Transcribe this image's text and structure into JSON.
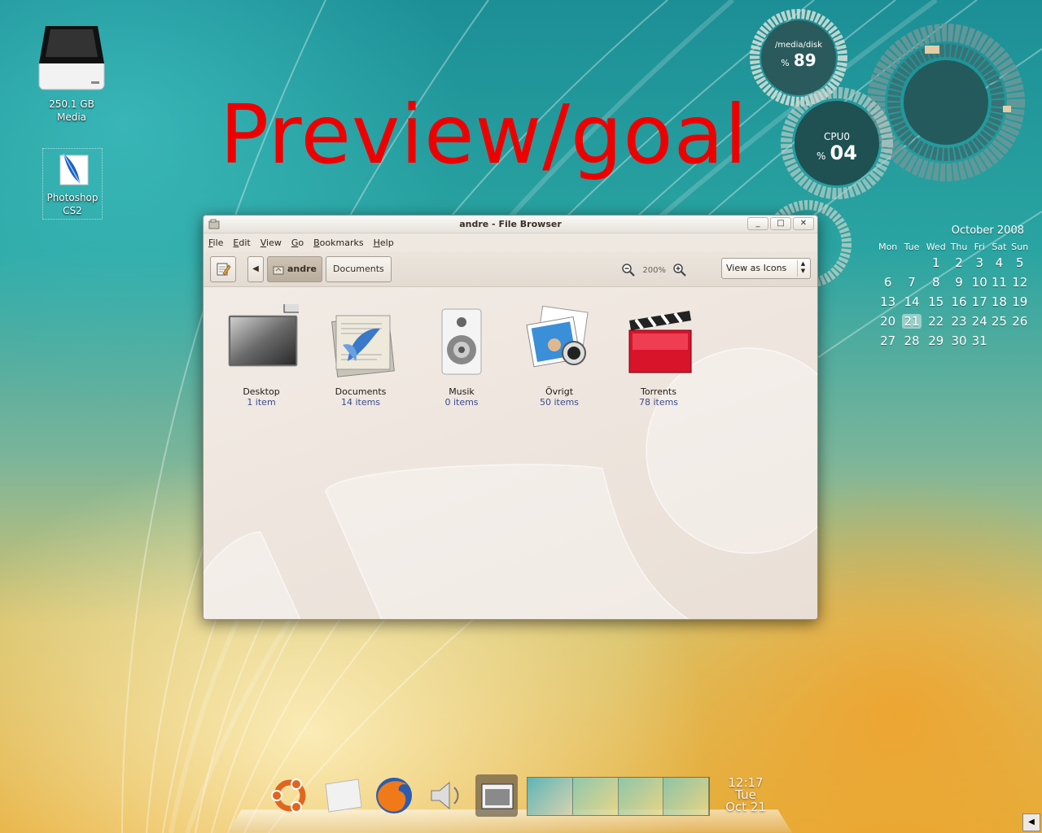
{
  "overlay_title": "Preview/goal",
  "desktop": {
    "icons": [
      {
        "label": "250.1 GB\nMedia",
        "icon": "hard-drive-icon"
      },
      {
        "label": "Photoshop\nCS2",
        "icon": "photoshop-feather-icon"
      }
    ]
  },
  "widgets": {
    "disk": {
      "path": "/media/disk",
      "pct_symbol": "%",
      "value": "89"
    },
    "cpu": {
      "label": "CPU0",
      "pct_symbol": "%",
      "value": "04"
    },
    "calendar": {
      "month": "October 2008",
      "weekdays": [
        "Mon",
        "Tue",
        "Wed",
        "Thu",
        "Fri",
        "Sat",
        "Sun"
      ],
      "weeks": [
        [
          "",
          "",
          "1",
          "2",
          "3",
          "4",
          "5"
        ],
        [
          "6",
          "7",
          "8",
          "9",
          "10",
          "11",
          "12"
        ],
        [
          "13",
          "14",
          "15",
          "16",
          "17",
          "18",
          "19"
        ],
        [
          "20",
          "21",
          "22",
          "23",
          "24",
          "25",
          "26"
        ],
        [
          "27",
          "28",
          "29",
          "30",
          "31",
          "",
          ""
        ]
      ],
      "today": "21"
    }
  },
  "window": {
    "title": "andre - File Browser",
    "buttons": {
      "minimize": "_",
      "maximize": "□",
      "close": "✕"
    },
    "menu": [
      {
        "key": "F",
        "rest": "ile"
      },
      {
        "key": "E",
        "rest": "dit"
      },
      {
        "key": "V",
        "rest": "iew"
      },
      {
        "key": "G",
        "rest": "o"
      },
      {
        "key": "B",
        "rest": "ookmarks"
      },
      {
        "key": "H",
        "rest": "elp"
      }
    ],
    "toolbar": {
      "back_glyph": "◀",
      "crumbs": [
        "andre",
        "Documents"
      ],
      "zoom_level": "200%",
      "view_mode": "View as Icons",
      "view_arrows": "▲\n▼"
    },
    "items": [
      {
        "name": "Desktop",
        "count": "1 item"
      },
      {
        "name": "Documents",
        "count": "14 items"
      },
      {
        "name": "Musik",
        "count": "0 items"
      },
      {
        "name": "Övrigt",
        "count": "50 items"
      },
      {
        "name": "Torrents",
        "count": "78 items"
      }
    ]
  },
  "dock": {
    "apps": [
      "ubuntu-logo-icon",
      "folder-icon",
      "firefox-icon",
      "volume-icon",
      "file-browser-icon"
    ],
    "clock": {
      "time": "12:17",
      "day": "Tue",
      "date": "Oct 21"
    }
  },
  "corner_button": "◀"
}
